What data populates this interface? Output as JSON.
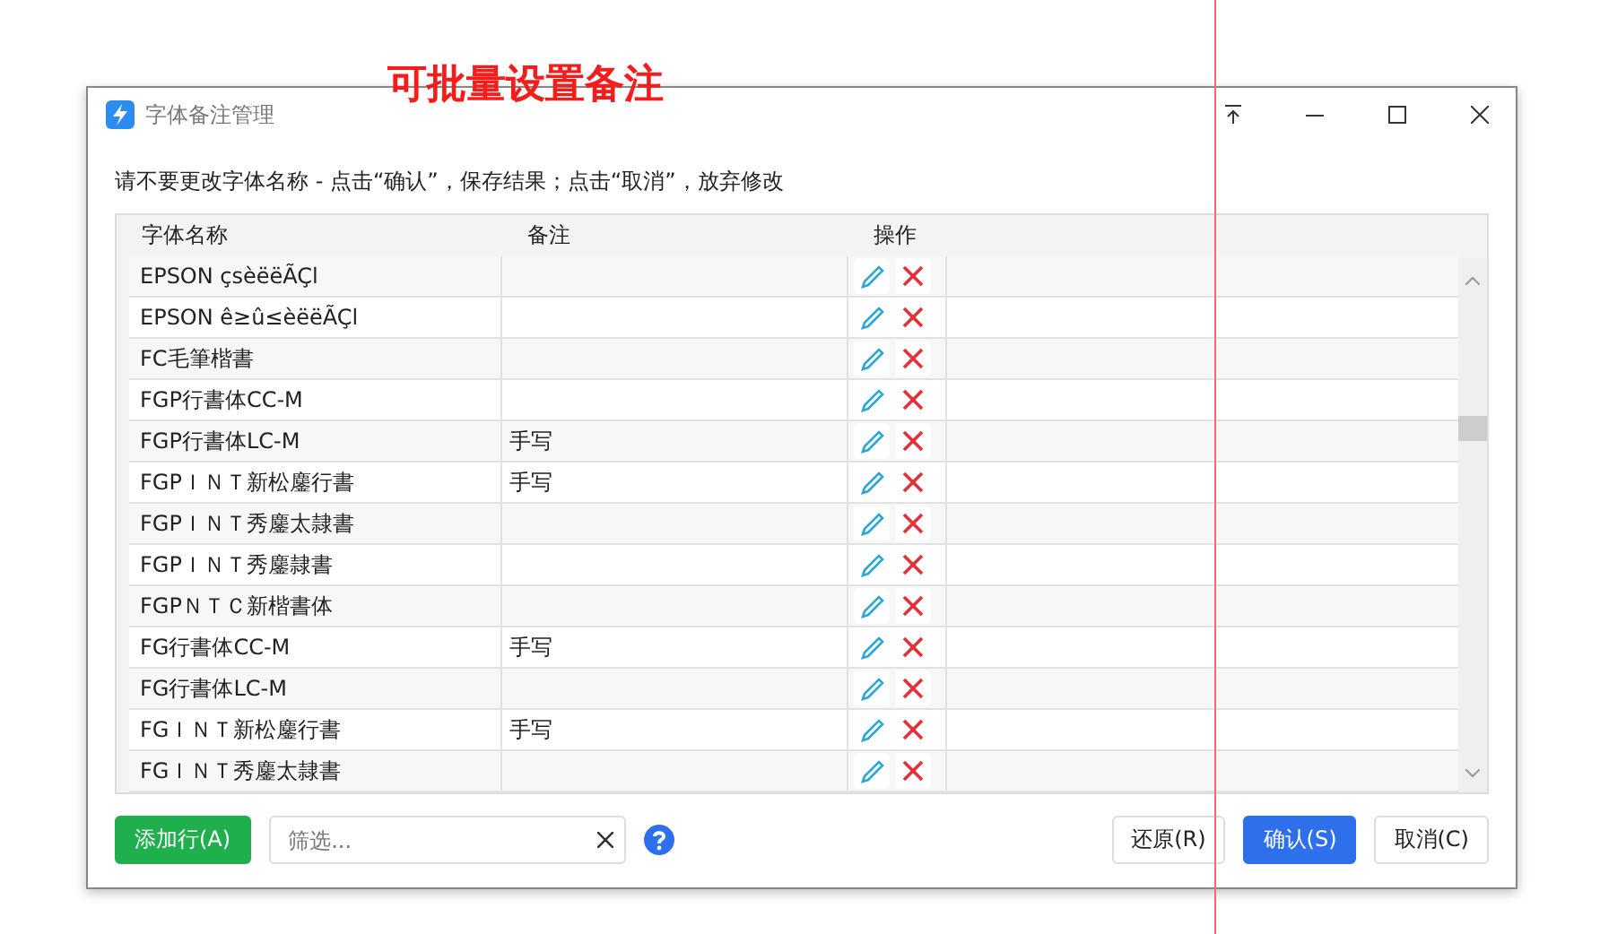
{
  "annotation": "可批量设置备注",
  "window": {
    "title": "字体备注管理"
  },
  "instruction": "请不要更改字体名称 - 点击“确认”，保存结果；点击“取消”，放弃修改",
  "table": {
    "columns": [
      "字体名称",
      "备注",
      "操作"
    ],
    "rows": [
      {
        "name": "EPSON çsèëëÃÇl",
        "remark": ""
      },
      {
        "name": "EPSON ê≥û≤èëëÃÇl",
        "remark": ""
      },
      {
        "name": "FC毛筆楷書",
        "remark": ""
      },
      {
        "name": "FGP行書体CC-M",
        "remark": ""
      },
      {
        "name": "FGP行書体LC-M",
        "remark": "手写"
      },
      {
        "name": "FGPＩＮＴ新松鏖行書",
        "remark": "手写"
      },
      {
        "name": "FGPＩＮＴ秀鏖太隷書",
        "remark": ""
      },
      {
        "name": "FGPＩＮＴ秀鏖隷書",
        "remark": ""
      },
      {
        "name": "FGPＮＴＣ新楷書体",
        "remark": ""
      },
      {
        "name": "FG行書体CC-M",
        "remark": "手写"
      },
      {
        "name": "FG行書体LC-M",
        "remark": ""
      },
      {
        "name": "FGＩＮＴ新松鏖行書",
        "remark": "手写"
      },
      {
        "name": "FGＩＮＴ秀鏖太隷書",
        "remark": ""
      }
    ]
  },
  "footer": {
    "add_button": "添加行(A)",
    "filter": {
      "placeholder": "筛选..."
    },
    "buttons": [
      "还原(R)",
      "确认(S)",
      "取消(C)"
    ]
  }
}
